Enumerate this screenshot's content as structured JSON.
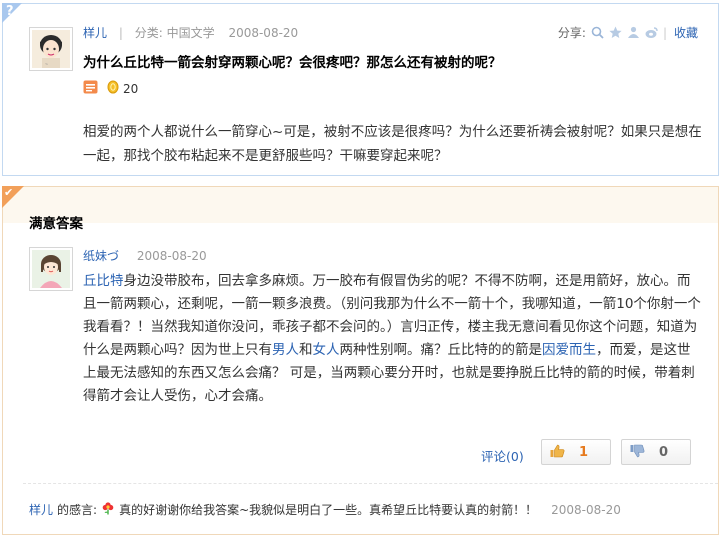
{
  "question": {
    "badge": "?",
    "asker": "样儿",
    "separator": "|",
    "category_label": "分类:",
    "category": "中国文学",
    "date": "2008-08-20",
    "share_label": "分享:",
    "favorite_label": "收藏",
    "title": "为什么丘比特一箭会射穿两颗心呢？会很疼吧？那怎么还有被射的呢？",
    "reward": "20",
    "body": "相爱的两个人都说什么一箭穿心~可是，被射不应该是很疼吗？为什么还要祈祷会被射呢？如果只是想在一起，那找个胶布粘起来不是更舒服些吗？干嘛要穿起来呢？"
  },
  "answer": {
    "section_title": "满意答案",
    "answerer": "纸妹づ",
    "date": "2008-08-20",
    "body": {
      "link_cupid": "丘比特",
      "t1": "身边没带胶布，回去拿多麻烦。万一胶布有假冒伪劣的呢？不得不防啊，还是用箭好，放心。而且一箭两颗心，还剩呢，一箭一颗多浪费。（别问我那为什么不一箭十个，我哪知道，一箭10个你射一个我看看？！当然我知道你没问，乖孩子都不会问的。）言归正传，楼主我无意间看见你这个问题，知道为什么是两颗心吗？因为世上只有",
      "link_man": "男人",
      "t2": "和",
      "link_woman": "女人",
      "t3": "两种性别啊。痛？丘比特的的箭是",
      "link_love": "因爱而生",
      "t4": "，而爱，是这世上最无法感知的东西又怎么会痛？ 可是，当两颗心要分开时，也就是要挣脱丘比特的箭的时候，带着刺得箭才会让人受伤，心才会痛。"
    },
    "comment_label": "评论(0)",
    "upvotes": "1",
    "downvotes": "0"
  },
  "thanks": {
    "user": "样儿",
    "label": "的感言:",
    "text": "真的好谢谢你给我答案~我貌似是明白了一些。真希望丘比特要认真的射箭！！",
    "date": "2008-08-20"
  },
  "colors": {
    "link": "#2d64b3",
    "question_border": "#c3d9f1",
    "answer_border": "#f0d8b9",
    "vote_up_count": "#e67a1e"
  },
  "icons": {
    "share": [
      "search-share-icon",
      "qzone-share-icon",
      "renren-share-icon",
      "weibo-share-icon"
    ],
    "question": [
      "question-tag-icon",
      "coin-icon"
    ],
    "vote": [
      "thumb-up-icon",
      "thumb-down-icon"
    ],
    "thanks": "flower-icon"
  }
}
